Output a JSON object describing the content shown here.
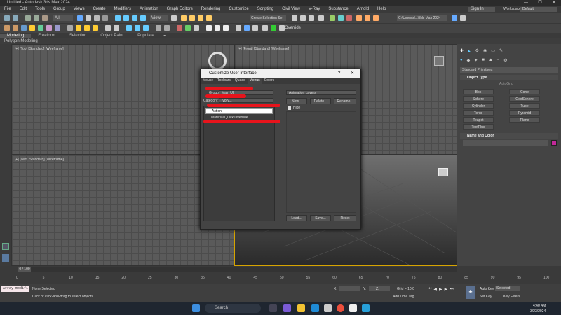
{
  "window": {
    "title": "Untitled - Autodesk 3ds Max 2024",
    "controls": [
      "—",
      "❐",
      "✕"
    ]
  },
  "menu": [
    "File",
    "Edit",
    "Tools",
    "Group",
    "Views",
    "Create",
    "Modifiers",
    "Animation",
    "Graph Editors",
    "Rendering",
    "Customize",
    "Scripting",
    "Civil View",
    "V-Ray",
    "Substance",
    "Arnold",
    "Help"
  ],
  "account": {
    "sign_in": "Sign In",
    "workspaces_label": "Workspaces:",
    "workspace": "Default"
  },
  "toolbar": {
    "filter": "All",
    "view_select": "View",
    "selection_set": "Create Selection Se",
    "overrides": "Override",
    "project": "C:\\Users\\d...\\3ds Max 2024"
  },
  "ribbon": {
    "tabs": [
      "Modeling",
      "Freeform",
      "Selection",
      "Object Paint",
      "Populate"
    ],
    "active": "Modeling",
    "subtitle": "Polygon Modeling"
  },
  "viewports": {
    "top": "[+] [Top] [Standard] [Wireframe]",
    "front": "[+] [Front] [Standard] [Wireframe]",
    "left": "[+] [Left] [Standard] [Wireframe]",
    "persp": ""
  },
  "command_panel": {
    "dropdown": "Standard Primitives",
    "object_type_header": "Object Type",
    "autogrid": "AutoGrid",
    "buttons": [
      "Box",
      "Cone",
      "Sphere",
      "GeoSphere",
      "Cylinder",
      "Tube",
      "Torus",
      "Pyramid",
      "Teapot",
      "Plane",
      "TextPlus"
    ],
    "name_color_header": "Name and Color",
    "color": "#c2289a"
  },
  "dialog": {
    "title": "Customize User Interface",
    "tabs": [
      "Mouse",
      "Toolbars",
      "Quads",
      "Menus",
      "Colors"
    ],
    "group_label": "Group:",
    "group_value": "Main UI",
    "category_label": "Category:",
    "category_value": "Ivory...",
    "list_items": [
      "Action",
      "Material Quick Override"
    ],
    "right_combo": "Animation Layers",
    "new_btn": "New...",
    "delete_btn": "Delete...",
    "rename_btn": "Rename...",
    "hide_label": "Hide",
    "load_btn": "Load...",
    "save_btn": "Save...",
    "reset_btn": "Reset"
  },
  "timeline": {
    "frame": "0 / 100",
    "ticks": [
      "0",
      "5",
      "10",
      "15",
      "20",
      "25",
      "30",
      "35",
      "40",
      "45",
      "50",
      "55",
      "60",
      "65",
      "70",
      "75",
      "80",
      "85",
      "90",
      "95",
      "100"
    ]
  },
  "status": {
    "maxscript": "Array modifi",
    "selection": "None Selected",
    "hint": "Click or click-and-drag to select objects",
    "x_label": "X:",
    "y_label": "Y:",
    "z_label": "Z:",
    "grid": "Grid = 10.0",
    "add_time_tag": "Add Time Tag",
    "autokey": "Auto Key",
    "set_key": "Set Key",
    "selected": "Selected",
    "key_filters": "Key Filters..."
  },
  "taskbar": {
    "search": "Search",
    "time": "4:40 AM",
    "date": "3/23/2024"
  }
}
